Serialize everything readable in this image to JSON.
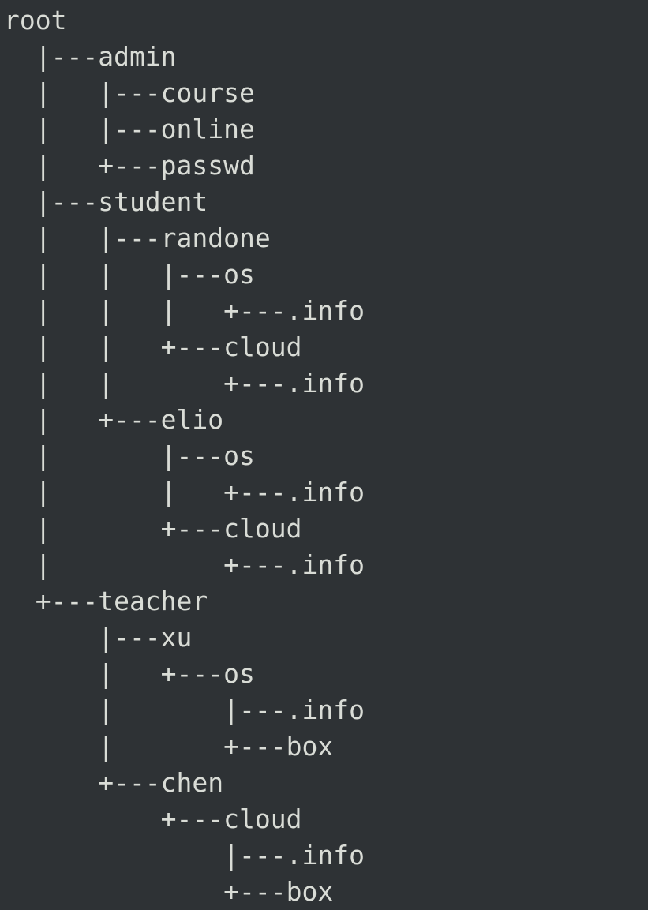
{
  "tree": {
    "lines": [
      "root",
      "  |---admin",
      "  |   |---course",
      "  |   |---online",
      "  |   +---passwd",
      "  |---student",
      "  |   |---randone",
      "  |   |   |---os",
      "  |   |   |   +---.info",
      "  |   |   +---cloud",
      "  |   |       +---.info",
      "  |   +---elio",
      "  |       |---os",
      "  |       |   +---.info",
      "  |       +---cloud",
      "  |           +---.info",
      "  +---teacher",
      "      |---xu",
      "      |   +---os",
      "      |       |---.info",
      "      |       +---box",
      "      +---chen",
      "          +---cloud",
      "              |---.info",
      "              +---box"
    ]
  }
}
